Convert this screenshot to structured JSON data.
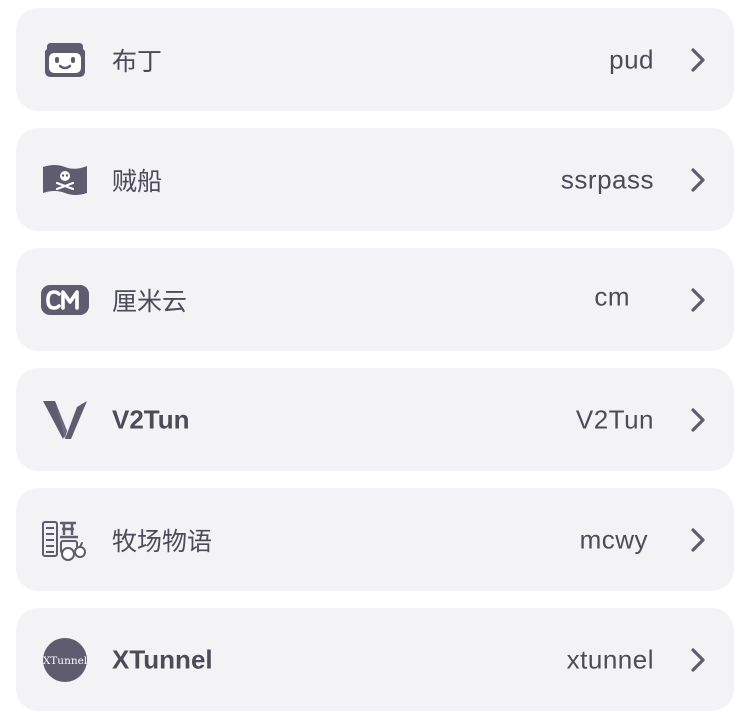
{
  "colors": {
    "card_bg": "#f3f3f6",
    "text": "#4c4b58",
    "icon": "#5e5c6e"
  },
  "items": [
    {
      "name": "布丁",
      "code": "pud",
      "icon": "pudding-chat-icon"
    },
    {
      "name": "贼船",
      "code": "ssrpass",
      "icon": "pirate-flag-icon"
    },
    {
      "name": "厘米云",
      "code": "cm",
      "icon": "cm-logo-icon"
    },
    {
      "name": "V2Tun",
      "code": "V2Tun",
      "icon": "v2tun-logo-icon"
    },
    {
      "name": "牧场物语",
      "code": "mcwy",
      "icon": "ranch-logo-icon"
    },
    {
      "name": "XTunnel",
      "code": "xtunnel",
      "icon": "xtunnel-logo-icon",
      "icon_text": "XTunnel"
    }
  ]
}
